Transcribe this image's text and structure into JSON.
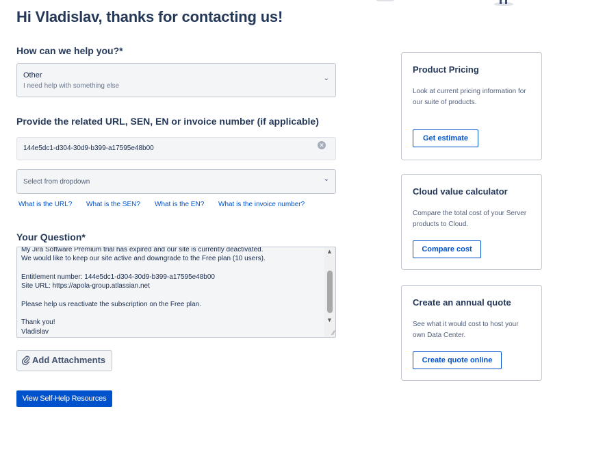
{
  "page": {
    "title": "Hi Vladislav, thanks for contacting us!"
  },
  "help": {
    "label": "How can we help you?*",
    "selected_option": "Other",
    "selected_description": "I need help with something else"
  },
  "related": {
    "label": "Provide the related URL, SEN, EN or invoice number (if applicable)",
    "input_value": "144e5dc1-d304-30d9-b399-a17595e48b00",
    "dropdown_placeholder": "Select from dropdown",
    "links": [
      "What is the URL?",
      "What is the SEN?",
      "What is the EN?",
      "What is the invoice number?"
    ]
  },
  "question": {
    "label": "Your Question*",
    "text": "My Jira Software Premium trial has expired and our site is currently deactivated.\nWe would like to keep our site active and downgrade to the Free plan (10 users).\n\nEntitlement number: 144e5dc1-d304-30d9-b399-a17595e48b00\nSite URL: https://apola-group.atlassian.net\n\nPlease help us reactivate the subscription on the Free plan.\n\nThank you!\nVladislav"
  },
  "attachments": {
    "label": "Add Attachments"
  },
  "self_help": {
    "label": "View Self-Help Resources"
  },
  "cards": [
    {
      "title": "Product Pricing",
      "description": "Look at current pricing information for our suite of products.",
      "button": "Get estimate"
    },
    {
      "title": "Cloud value calculator",
      "description": "Compare the total cost of your Server products to Cloud.",
      "button": "Compare cost"
    },
    {
      "title": "Create an annual quote",
      "description": "See what it would cost to host your own Data Center.",
      "button": "Create quote online"
    }
  ],
  "icons": {
    "dropdown": "chevron-down-icon",
    "clear": "clear-icon",
    "attach": "paperclip-icon"
  },
  "colors": {
    "primary": "#0052cc",
    "heading": "#253858",
    "field_bg": "#f4f5f7"
  }
}
